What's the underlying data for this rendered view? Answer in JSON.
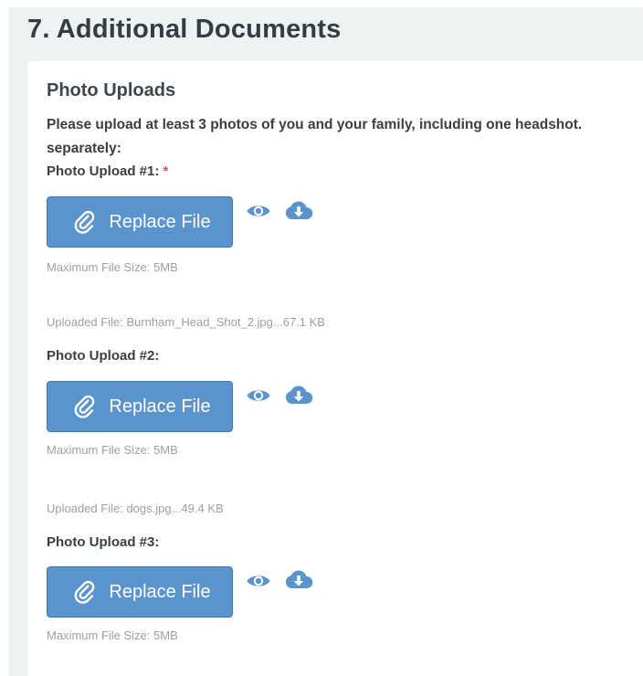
{
  "section": {
    "title": "7. Additional Documents"
  },
  "card": {
    "title": "Photo Uploads",
    "instruction_line1": "Please upload at least 3 photos of you and your family, including one headshot.",
    "instruction_line2": "separately:"
  },
  "uploads": [
    {
      "label": "Photo Upload #1:",
      "required_marker": "*",
      "button_label": "Replace File",
      "max_size": "Maximum File Size: 5MB",
      "uploaded_file": "Uploaded File: Burnham_Head_Shot_2.jpg...67.1 KB"
    },
    {
      "label": "Photo Upload #2:",
      "button_label": "Replace File",
      "max_size": "Maximum File Size: 5MB",
      "uploaded_file": "Uploaded File: dogs.jpg...49.4 KB"
    },
    {
      "label": "Photo Upload #3:",
      "button_label": "Replace File",
      "max_size": "Maximum File Size: 5MB"
    }
  ],
  "icons": {
    "attach": "paperclip-icon",
    "view": "eye-icon",
    "download": "cloud-download-icon"
  },
  "colors": {
    "button": "#5b93cc",
    "button_border": "#3f79b3",
    "icon": "#5b93cc",
    "required": "#d9534f",
    "panel_bg": "#eef2f3"
  }
}
